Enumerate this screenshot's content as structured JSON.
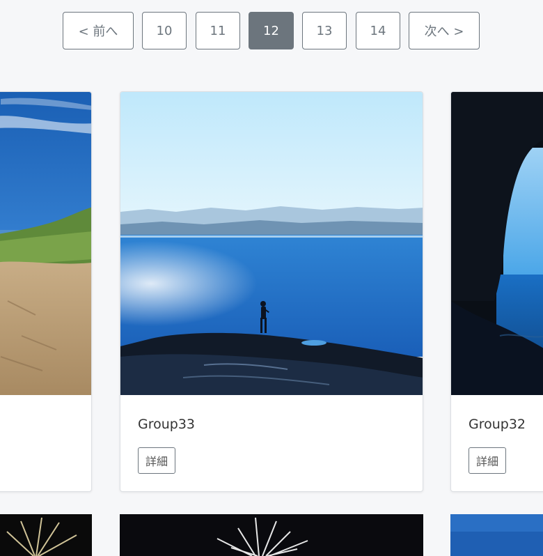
{
  "pagination": {
    "prev_label": "< 前へ",
    "pages": [
      "10",
      "11",
      "12",
      "13",
      "14"
    ],
    "current_page": "12",
    "next_label": "次へ >"
  },
  "cards": [
    {
      "title": "",
      "button_label": ""
    },
    {
      "title": "Group33",
      "button_label": "詳細"
    },
    {
      "title": "Group32",
      "button_label": "詳細"
    }
  ],
  "colors": {
    "page_bg": "#f6f7f9",
    "button_border": "#6c757d",
    "active_page_bg": "#6c757d"
  }
}
